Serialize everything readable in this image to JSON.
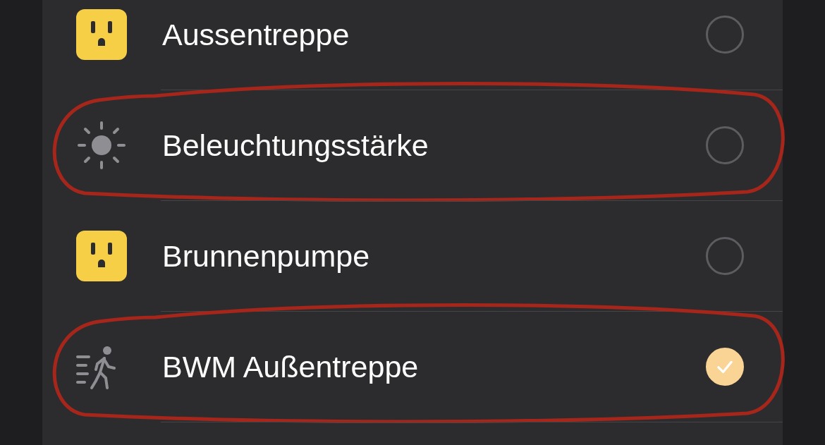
{
  "accessories": [
    {
      "kind": "outlet",
      "name": "Aussentreppe",
      "selected": false,
      "highlighted": false
    },
    {
      "kind": "sensor-light",
      "name": "Beleuchtungsstärke",
      "selected": false,
      "highlighted": true
    },
    {
      "kind": "outlet",
      "name": "Brunnenpumpe",
      "selected": false,
      "highlighted": false
    },
    {
      "kind": "sensor-motion",
      "name": "BWM Außentreppe",
      "selected": true,
      "highlighted": true
    }
  ]
}
